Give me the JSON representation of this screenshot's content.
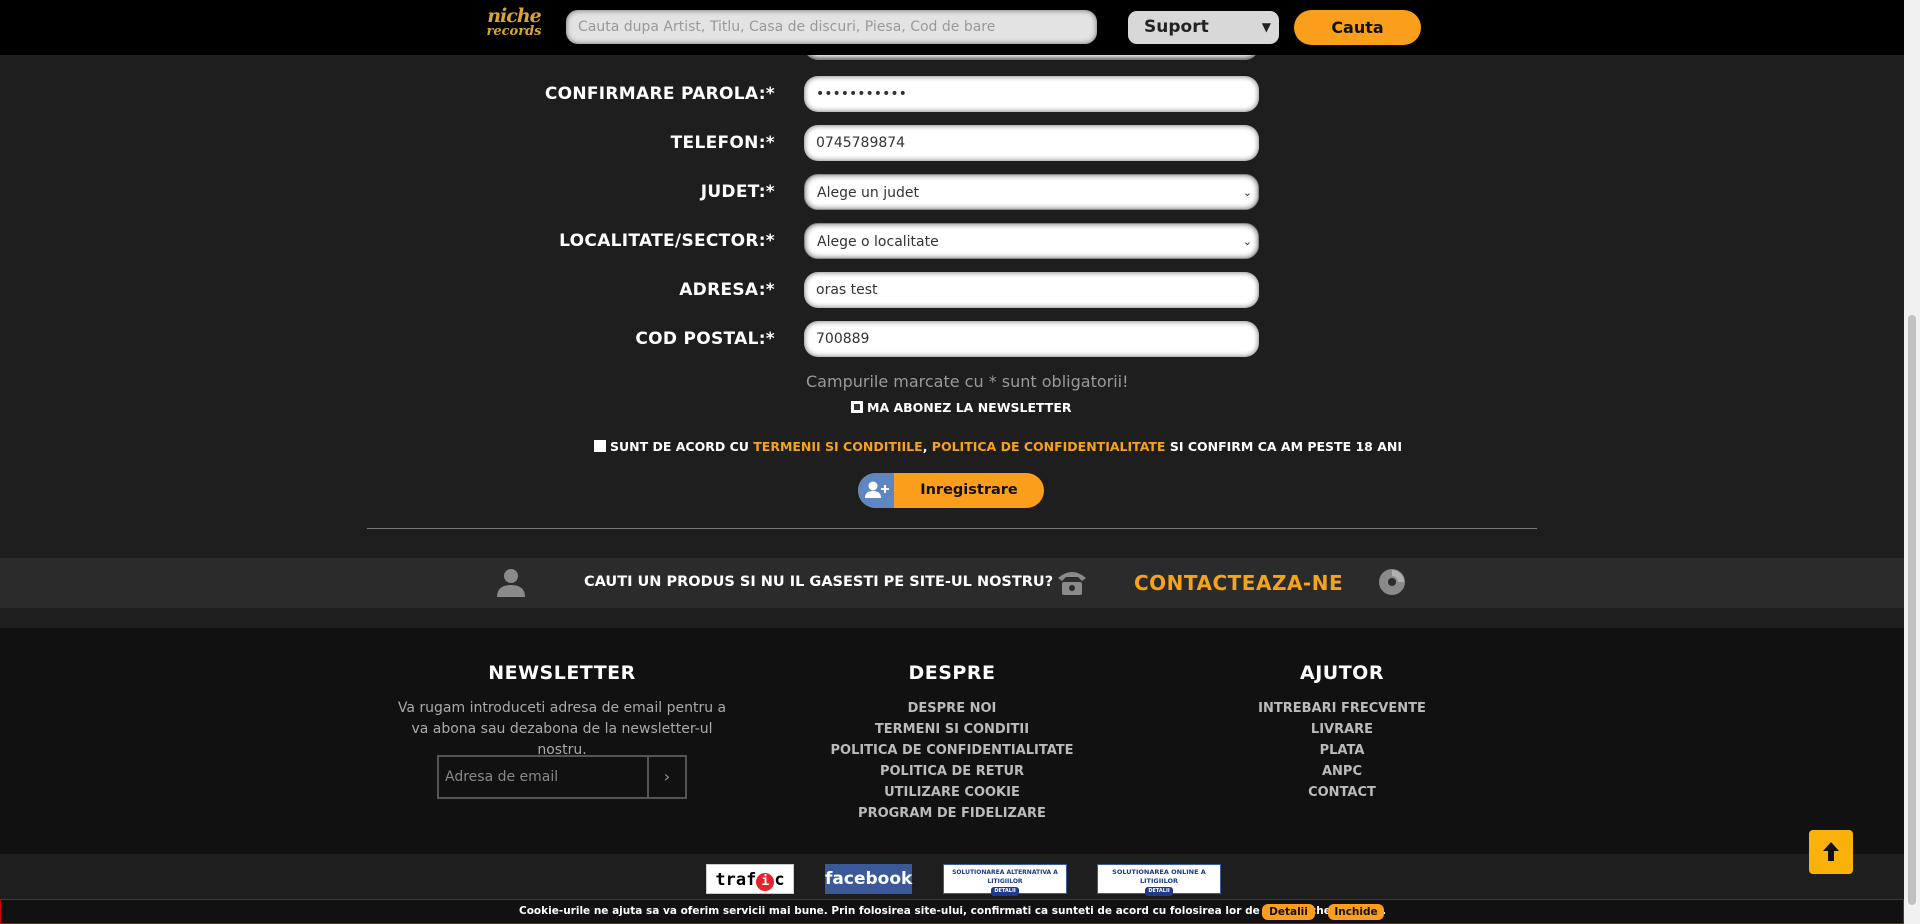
{
  "header": {
    "logo_line1": "niche",
    "logo_line2": "records",
    "search_placeholder": "Cauta dupa Artist, Titlu, Casa de discuri, Piesa, Cod de bare",
    "support_select": "Suport",
    "search_button": "Cauta"
  },
  "form": {
    "confirm_password": {
      "label": "CONFIRMARE PAROLA:*",
      "value": "•••••••••••"
    },
    "phone": {
      "label": "TELEFON:*",
      "value": "0745789874"
    },
    "county": {
      "label": "JUDET:*",
      "value": "Alege un judet"
    },
    "locality": {
      "label": "LOCALITATE/SECTOR:*",
      "value": "Alege o localitate"
    },
    "address": {
      "label": "ADRESA:*",
      "value": "oras test"
    },
    "postal_code": {
      "label": "COD POSTAL:*",
      "value": "700889"
    },
    "required_note": "Campurile marcate cu * sunt obligatorii!",
    "newsletter_checkbox": "MA ABONEZ LA NEWSLETTER",
    "newsletter_checked": true,
    "terms_prefix": "SUNT DE ACORD CU ",
    "terms_link": "TERMENII SI CONDITIILE",
    "terms_comma": ", ",
    "privacy_link": "POLITICA DE CONFIDENTIALITATE",
    "terms_suffix": " SI CONFIRM CA AM PESTE 18 ANI",
    "terms_checked": false,
    "register_button": "Inregistrare"
  },
  "contact_band": {
    "question": "CAUTI UN PRODUS SI NU IL GASESTI PE SITE-UL NOSTRU?",
    "contact_link": "CONTACTEAZA-NE"
  },
  "footer": {
    "newsletter": {
      "title": "NEWSLETTER",
      "description": "Va rugam introduceti adresa de email pentru a va abona sau dezabona de la newsletter-ul nostru.",
      "email_placeholder": "Adresa de email",
      "submit_glyph": "›"
    },
    "despre": {
      "title": "DESPRE",
      "links": [
        "DESPRE NOI",
        "TERMENI SI CONDITII",
        "POLITICA DE CONFIDENTIALITATE",
        "POLITICA DE RETUR",
        "UTILIZARE COOKIE",
        "PROGRAM DE FIDELIZARE"
      ]
    },
    "ajutor": {
      "title": "AJUTOR",
      "links": [
        "INTREBARI FRECVENTE",
        "LIVRARE",
        "PLATA",
        "ANPC",
        "CONTACT"
      ]
    }
  },
  "partners": {
    "trafic_pre": "traf",
    "trafic_i": "i",
    "trafic_post": "c",
    "facebook": "facebook",
    "anpc_sal_title": "SOLUTIONAREA ALTERNATIVA A LITIGIILOR",
    "anpc_sal_tag": "DETALII",
    "anpc_sol_title": "SOLUTIONAREA ONLINE A LITIGIILOR",
    "anpc_sol_tag": "DETALII"
  },
  "cookie_bar": {
    "text": "Cookie-urile ne ajuta sa va oferim servicii mai bune. Prin folosirea site-ului, confirmati ca sunteti de acord cu folosirea lor de catre Niche Records.",
    "details_button": "Detalii",
    "close_button": "Inchide"
  },
  "colors": {
    "accent": "#fa9e1b",
    "link": "#f5a21d",
    "user_icon_bg": "#5d86c2"
  }
}
